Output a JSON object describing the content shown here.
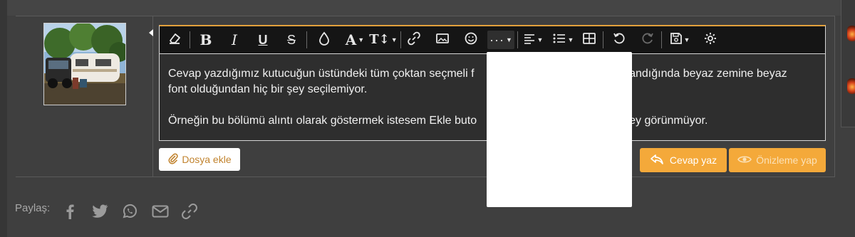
{
  "editor": {
    "toolbar": {
      "clear_format": "clear-formatting-icon",
      "bold": "B",
      "italic": "I",
      "underline": "U",
      "strike": "S",
      "font_size": "T↕"
    },
    "content": {
      "paragraph_1_a": "Cevap yazdığımız kutucuğun üstündeki tüm çoktan seçmeli f",
      "paragraph_1_b": "klandığında beyaz zemine beyaz",
      "paragraph_1_c": "font olduğundan hiç bir şey seçilemiyor.",
      "paragraph_2_a": "Örneğin bu bölümü alıntı olarak göstermek istesem Ekle buto",
      "paragraph_2_b": "şey görünmüyor."
    }
  },
  "actions": {
    "attach_label": "Dosya ekle",
    "reply_label": "Cevap yaz",
    "preview_label": "Önizleme yap"
  },
  "share": {
    "label": "Paylaş:"
  },
  "colors": {
    "accent": "#f4a93a",
    "background": "#3f3f3f",
    "toolbar": "#151515"
  }
}
